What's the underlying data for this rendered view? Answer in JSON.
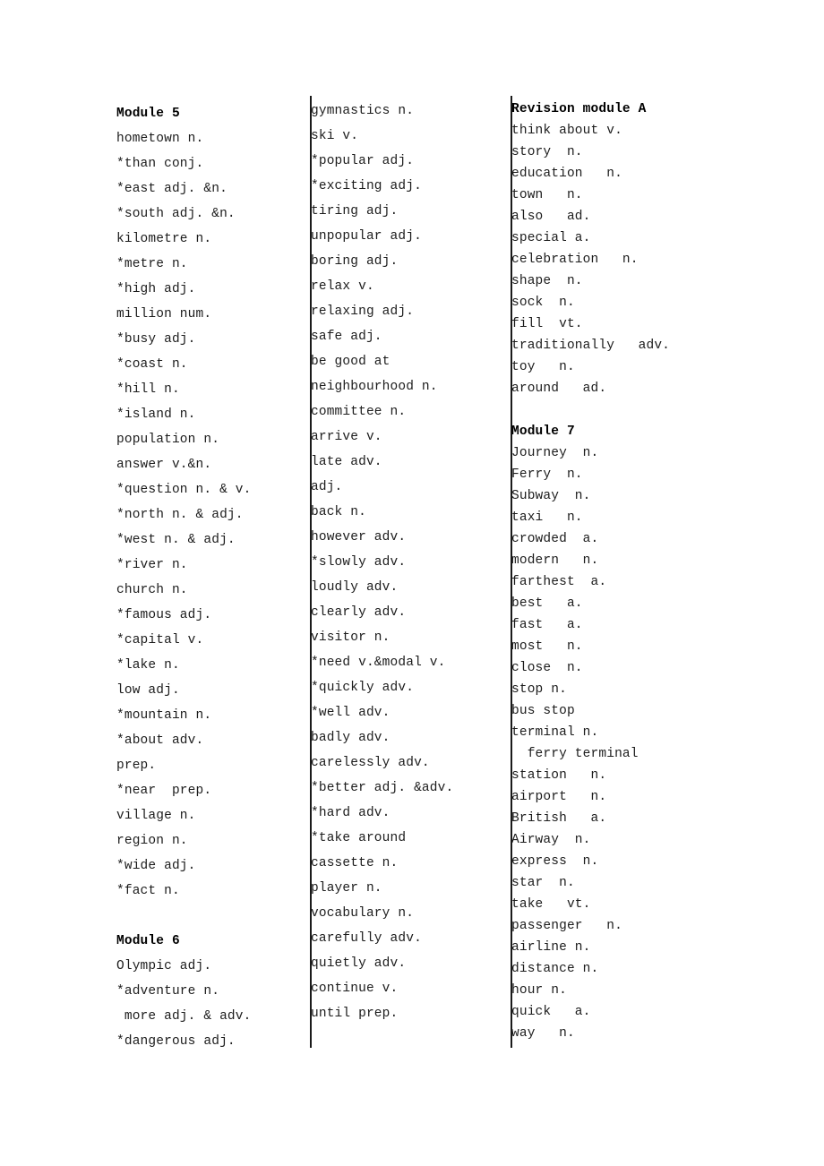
{
  "document": {
    "title": "Vocabulary word list",
    "columns": [
      {
        "name": "column-left",
        "sections": [
          {
            "heading": "Module 5",
            "entries": [
              "hometown n.",
              "*than conj.",
              "*east adj. &n.",
              "*south adj. &n.",
              "kilometre n.",
              "*metre n.",
              "*high adj.",
              "million num.",
              "*busy adj.",
              "*coast n.",
              "*hill n.",
              "*island n.",
              "population n.",
              "answer v.&n.",
              "*question n. & v.",
              "*north n. & adj.",
              "*west n. & adj.",
              "*river n.",
              "church n.",
              "*famous adj.",
              "*capital v.",
              "*lake n.",
              "low adj.",
              "*mountain n.",
              "*about adv.",
              "prep.",
              "*near  prep.",
              "village n.",
              "region n.",
              "*wide adj.",
              "*fact n."
            ]
          },
          {
            "heading": "Module 6",
            "entries": [
              "Olympic adj.",
              "*adventure n.",
              " more adj. & adv.",
              "*dangerous adj."
            ]
          }
        ]
      },
      {
        "name": "column-middle",
        "sections": [
          {
            "heading": "",
            "entries": [
              "gymnastics n.",
              "ski v.",
              "*popular adj.",
              "*exciting adj.",
              "tiring adj.",
              "unpopular adj.",
              "boring adj.",
              "relax v.",
              "relaxing adj.",
              "safe adj.",
              "be good at",
              "neighbourhood n.",
              "committee n.",
              "arrive v.",
              "late adv.",
              "adj.",
              "back n.",
              "however adv.",
              "*slowly adv.",
              "loudly adv.",
              "clearly adv.",
              "visitor n.",
              "*need v.&modal v.",
              "*quickly adv.",
              "*well adv.",
              "badly adv.",
              "carelessly adv.",
              "*better adj. &adv.",
              "*hard adv.",
              "*take around",
              "cassette n.",
              "player n.",
              "vocabulary n.",
              "carefully adv.",
              "quietly adv.",
              "continue v.",
              "until prep."
            ]
          }
        ]
      },
      {
        "name": "column-right",
        "sections": [
          {
            "heading": "Revision module A",
            "entries": [
              "think about v.",
              "story  n.",
              "education   n.",
              "town   n.",
              "also   ad.",
              "special a.",
              "celebration   n.",
              "shape  n.",
              "sock  n.",
              "fill  vt.",
              "traditionally   adv.",
              "toy   n.",
              "around   ad."
            ]
          },
          {
            "heading": "Module 7",
            "entries": [
              "Journey  n.",
              "Ferry  n.",
              "Subway  n.",
              "taxi   n.",
              "crowded  a.",
              "modern   n.",
              "farthest  a.",
              "best   a.",
              "fast   a.",
              "most   n.",
              "close  n.",
              "stop n.",
              "bus stop",
              "terminal n.",
              "  ferry terminal",
              "station   n.",
              "airport   n.",
              "British   a.",
              "Airway  n.",
              "express  n.",
              "star  n.",
              "take   vt.",
              "passenger   n.",
              "airline n.",
              "distance n.",
              "hour n.",
              "quick   a.",
              "way   n."
            ]
          }
        ]
      }
    ]
  }
}
